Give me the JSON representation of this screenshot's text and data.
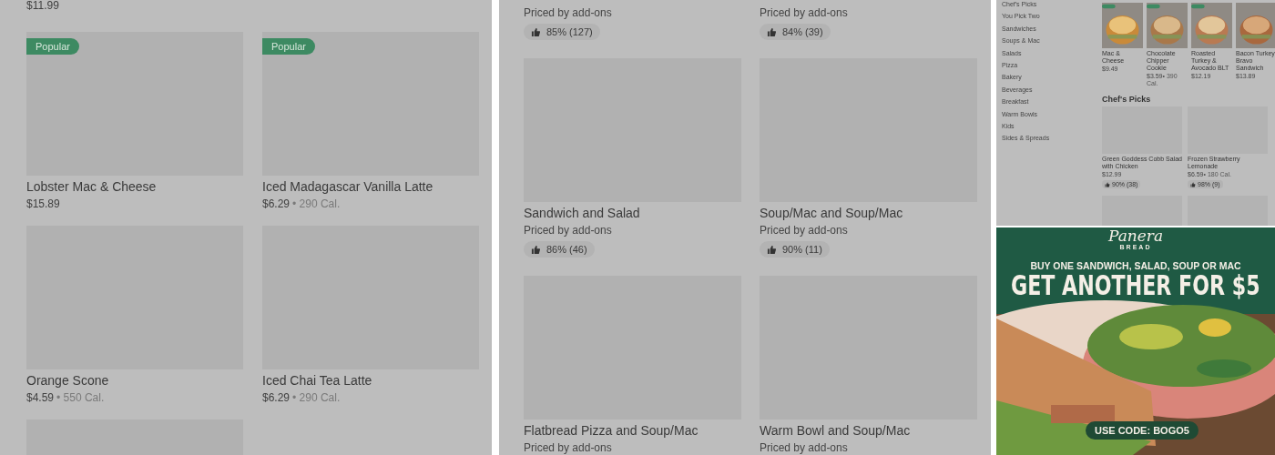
{
  "left_panel": {
    "top_price": "$11.99",
    "items": [
      {
        "name": "Lobster Mac & Cheese",
        "price": "$15.89",
        "popular": true,
        "badge": "Popular"
      },
      {
        "name": "Iced Madagascar Vanilla Latte",
        "price": "$6.29",
        "calories": "• 290 Cal.",
        "popular": true,
        "badge": "Popular"
      },
      {
        "name": "Orange Scone",
        "price": "$4.59",
        "calories": "• 550 Cal.",
        "popular": false
      },
      {
        "name": "Iced Chai Tea Latte",
        "price": "$6.29",
        "calories": "• 290 Cal.",
        "popular": false
      }
    ]
  },
  "middle_panel": {
    "top_items": [
      {
        "subtitle": "Priced by add-ons",
        "rating": "85% (127)"
      },
      {
        "subtitle": "Priced by add-ons",
        "rating": "84% (39)"
      }
    ],
    "items": [
      {
        "name": "Sandwich and Salad",
        "subtitle": "Priced by add-ons",
        "rating": "86% (46)"
      },
      {
        "name": "Soup/Mac and Soup/Mac",
        "subtitle": "Priced by add-ons",
        "rating": "90% (11)"
      },
      {
        "name": "Flatbread Pizza and Soup/Mac",
        "subtitle": "Priced by add-ons"
      },
      {
        "name": "Warm Bowl and Soup/Mac",
        "subtitle": "Priced by add-ons"
      }
    ]
  },
  "store_panel": {
    "sidebar": {
      "items": [
        "Chef's Picks",
        "You Pick Two",
        "Sandwiches",
        "Soups & Mac",
        "Salads",
        "Pizza",
        "Bakery",
        "Beverages",
        "Breakfast",
        "Warm Bowls",
        "Kids",
        "Sides & Spreads"
      ]
    },
    "featured": [
      {
        "name": "Mac & Cheese",
        "price": "$9.49"
      },
      {
        "name": "Chocolate Chipper Cookie",
        "price": "$3.59",
        "calories": "• 390 Cal."
      },
      {
        "name": "Roasted Turkey & Avocado BLT",
        "price": "$12.19"
      },
      {
        "name": "Bacon Turkey Bravo Sandwich",
        "price": "$13.89"
      }
    ],
    "section_title": "Chef's Picks",
    "picks": [
      {
        "name": "Green Goddess Cobb Salad with Chicken",
        "price": "$12.99",
        "rating": "90% (38)"
      },
      {
        "name": "Frozen Strawberry Lemonade",
        "price": "$6.59",
        "calories": "• 180 Cal.",
        "rating": "98% (9)"
      }
    ]
  },
  "ad": {
    "brand": "Panera",
    "brand_sub": "BREAD",
    "line_1": "BUY ONE SANDWICH, SALAD, SOUP OR MAC",
    "line_2": "GET ANOTHER FOR $5",
    "code": "USE CODE: BOGO5"
  }
}
